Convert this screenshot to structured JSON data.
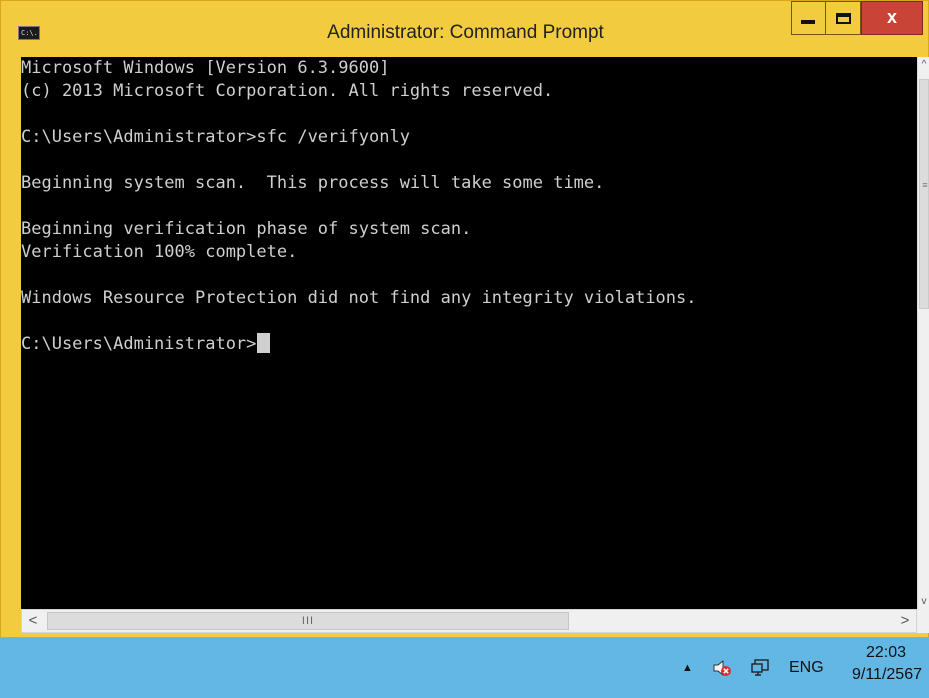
{
  "window": {
    "title": "Administrator: Command Prompt",
    "app_icon_text": "C:\\.",
    "close_label": "x",
    "colors": {
      "frame": "#f2cc3e",
      "close": "#c94337",
      "console_bg": "#000000",
      "console_fg": "#cfcfcf"
    }
  },
  "console": {
    "lines": [
      "Microsoft Windows [Version 6.3.9600]",
      "(c) 2013 Microsoft Corporation. All rights reserved.",
      "",
      "C:\\Users\\Administrator>sfc /verifyonly",
      "",
      "Beginning system scan.  This process will take some time.",
      "",
      "Beginning verification phase of system scan.",
      "Verification 100% complete.",
      "",
      "Windows Resource Protection did not find any integrity violations.",
      "",
      "C:\\Users\\Administrator>"
    ]
  },
  "scrollbars": {
    "vertical_up": "^",
    "vertical_down": "v",
    "vertical_grip": "≡",
    "horizontal_left": "<",
    "horizontal_right": ">",
    "horizontal_grip": "III"
  },
  "taskbar": {
    "tray_arrow": "▲",
    "icons": [
      "speaker-muted-icon",
      "network-icon"
    ],
    "language": "ENG",
    "time": "22:03",
    "date": "9/11/2567",
    "color": "#63b7e4"
  }
}
